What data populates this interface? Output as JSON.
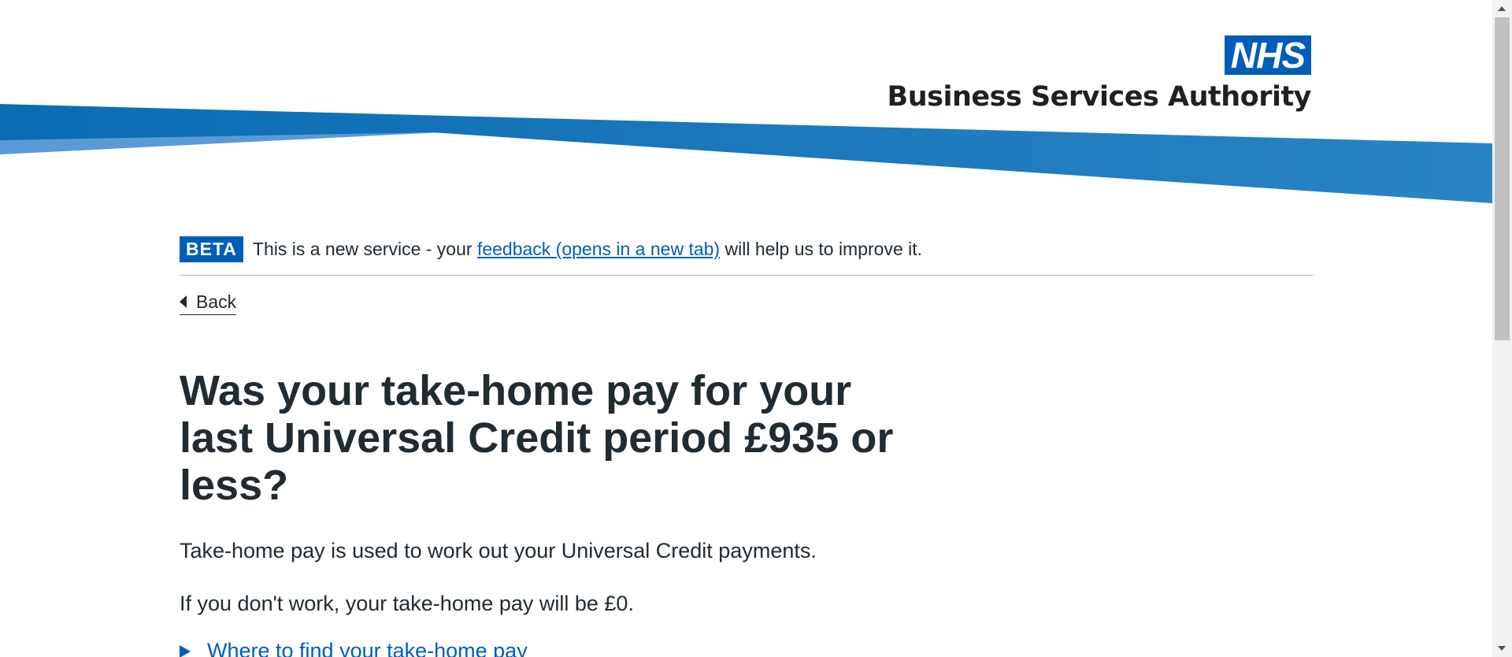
{
  "header": {
    "logo_nhs": "NHS",
    "logo_org": "Business Services Authority"
  },
  "phase_banner": {
    "tag": "BETA",
    "text_before": "This is a new service - your ",
    "link_text": "feedback (opens in a new tab)",
    "text_after": " will help us to improve it."
  },
  "nav": {
    "back_label": "Back"
  },
  "main": {
    "heading": "Was your take-home pay for your last Universal Credit period £935 or less?",
    "paragraph_1": "Take-home pay is used to work out your Universal Credit payments.",
    "paragraph_2": "If you don't work, your take-home pay will be £0.",
    "details_summary": "Where to find your take-home pay"
  },
  "colors": {
    "nhs_blue": "#005eb8",
    "text": "#212b32",
    "swoosh_main": "#1a74b8",
    "swoosh_light": "#5a9ad6"
  }
}
